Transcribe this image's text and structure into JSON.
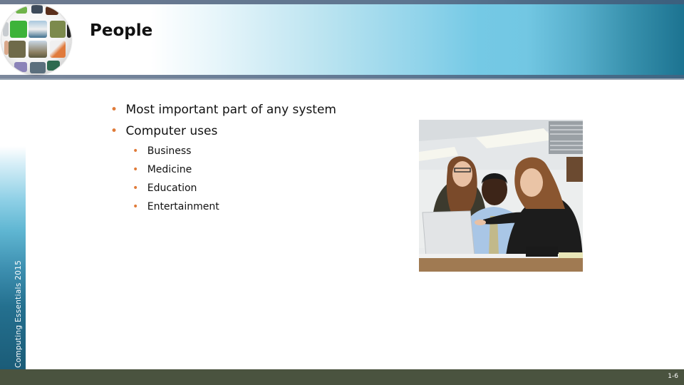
{
  "slide": {
    "title": "People",
    "bullets": [
      {
        "text": "Most important part of any system",
        "level": 1
      },
      {
        "text": "Computer uses",
        "level": 1,
        "children": [
          {
            "text": "Business"
          },
          {
            "text": "Medicine"
          },
          {
            "text": "Education"
          },
          {
            "text": "Entertainment"
          }
        ]
      }
    ],
    "bullet_glyph": "•",
    "side_label": "Computing Essentials 2015",
    "page_number": "1-6",
    "photo_alt": "Three people looking at a laptop in an office",
    "logo": "photo-globe-icon"
  },
  "colors": {
    "bullet": "#e07b39",
    "footer": "#4a533f",
    "header_dark": "#1c7391",
    "header_light": "#72c7e3"
  }
}
